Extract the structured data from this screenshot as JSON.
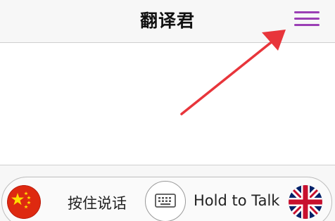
{
  "navbar": {
    "title": "翻译君",
    "menu_icon": "hamburger-menu-icon",
    "accent_color": "#9b3fb5"
  },
  "bottombar": {
    "source_flag_icon": "china-flag-icon",
    "source_label": "按住说话",
    "keyboard_icon": "keyboard-icon",
    "target_label": "Hold to Talk",
    "target_flag_icon": "uk-flag-icon"
  },
  "annotation": {
    "arrow_color": "#e8353b"
  }
}
